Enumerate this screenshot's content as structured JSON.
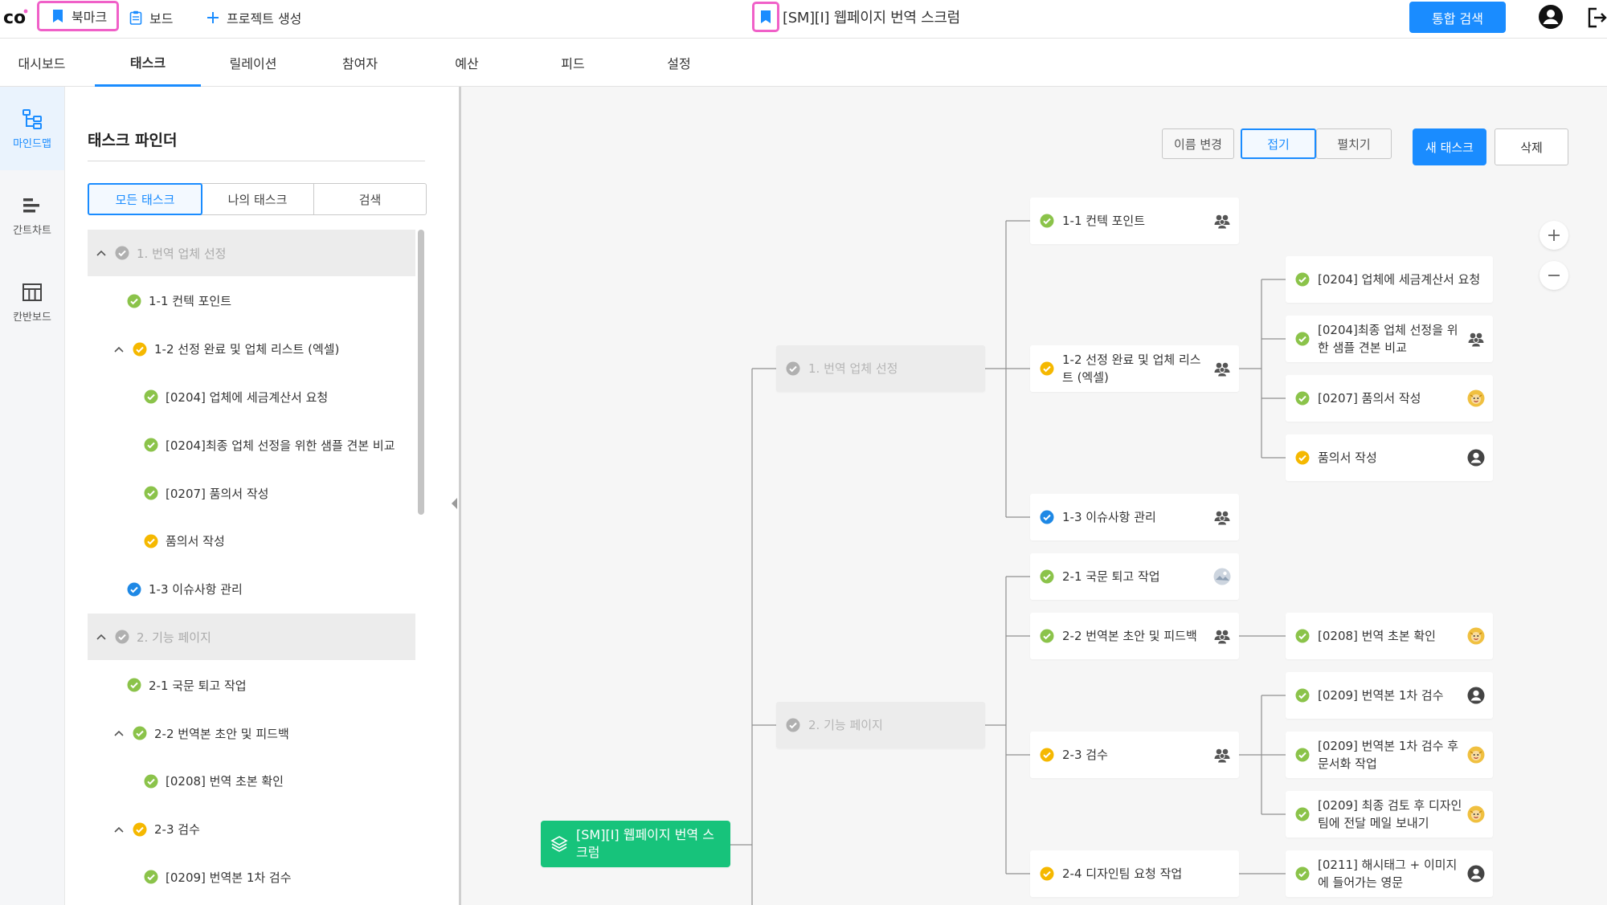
{
  "topbar": {
    "bookmark_label": "북마크",
    "board_label": "보드",
    "create_project_label": "프로젝트 생성",
    "project_title": "[SM][I] 웹페이지 번역 스크럼",
    "search_button": "통합 검색"
  },
  "nav": {
    "tabs": [
      "대시보드",
      "태스크",
      "릴레이션",
      "참여자",
      "예산",
      "피드",
      "설정"
    ],
    "active": "태스크"
  },
  "rail": {
    "items": [
      "마인드맵",
      "간트차트",
      "칸반보드"
    ],
    "active": "마인드맵"
  },
  "finder": {
    "title": "태스크 파인더",
    "filters": [
      "모든 태스크",
      "나의 태스크",
      "검색"
    ],
    "active_filter": "모든 태스크",
    "tree": [
      {
        "label": "1. 번역 업체 선정",
        "level": 0,
        "status": "gray",
        "caret": true
      },
      {
        "label": "1-1 컨텍 포인트",
        "level": 1,
        "status": "green",
        "caret": false
      },
      {
        "label": "1-2 선정 완료 및 업체 리스트 (엑셀)",
        "level": 1,
        "status": "yellow",
        "caret": true
      },
      {
        "label": "[0204] 업체에 세금계산서 요청",
        "level": 2,
        "status": "green",
        "caret": false
      },
      {
        "label": "[0204]최종 업체 선정을 위한 샘플 견본 비교",
        "level": 2,
        "status": "green",
        "caret": false
      },
      {
        "label": "[0207] 품의서 작성",
        "level": 2,
        "status": "green",
        "caret": false
      },
      {
        "label": "품의서 작성",
        "level": 2,
        "status": "yellow",
        "caret": false
      },
      {
        "label": "1-3 이슈사항 관리",
        "level": 1,
        "status": "blue",
        "caret": false
      },
      {
        "label": "2. 기능 페이지",
        "level": 0,
        "status": "gray",
        "caret": true
      },
      {
        "label": "2-1 국문 퇴고 작업",
        "level": 1,
        "status": "green",
        "caret": false
      },
      {
        "label": "2-2 번역본 초안 및 피드백",
        "level": 1,
        "status": "green",
        "caret": true
      },
      {
        "label": "[0208] 번역 초본 확인",
        "level": 2,
        "status": "green",
        "caret": false
      },
      {
        "label": "2-3 검수",
        "level": 1,
        "status": "yellow",
        "caret": true
      },
      {
        "label": "[0209] 번역본 1차 검수",
        "level": 2,
        "status": "green",
        "caret": false
      }
    ]
  },
  "toolbar": {
    "rename": "이름 변경",
    "collapse": "접기",
    "expand": "펼치기",
    "new_task": "새 태스크",
    "delete": "삭제"
  },
  "colors": {
    "accent": "#1a8cff",
    "highlight": "#f060c8",
    "green": "#8bc34a",
    "yellow": "#f5b800",
    "blue": "#1e88e5",
    "gray": "#b0b0b0",
    "root": "#17c37b"
  },
  "mindmap": {
    "root": {
      "label": "[SM][I] 웹페이지 번역 스크럼",
      "icon": "layers-icon"
    },
    "groups": [
      {
        "id": "g1",
        "label": "1. 번역 업체 선정",
        "status": "gray"
      },
      {
        "id": "g2",
        "label": "2. 기능 페이지",
        "status": "gray"
      }
    ],
    "tasks": [
      {
        "id": "t11",
        "label": "1-1 컨텍 포인트",
        "status": "green",
        "avatar": "group-icon"
      },
      {
        "id": "t12",
        "label": "1-2 선정 완료 및 업체 리스트 (엑셀)",
        "status": "yellow",
        "avatar": "group-icon"
      },
      {
        "id": "t13",
        "label": "1-3 이슈사항 관리",
        "status": "blue",
        "avatar": "group-icon"
      },
      {
        "id": "t21",
        "label": "2-1 국문 퇴고 작업",
        "status": "green",
        "avatar": "photo-avatar-icon"
      },
      {
        "id": "t22",
        "label": "2-2 번역본 초안 및 피드백",
        "status": "green",
        "avatar": "group-icon"
      },
      {
        "id": "t23",
        "label": "2-3 검수",
        "status": "yellow",
        "avatar": "group-icon"
      },
      {
        "id": "t24",
        "label": "2-4 디자인팀 요청 작업",
        "status": "yellow",
        "avatar": "none"
      }
    ],
    "subtasks": [
      {
        "id": "s1",
        "label": "[0204] 업체에 세금계산서 요청",
        "status": "green",
        "avatar": "none"
      },
      {
        "id": "s2",
        "label": "[0204]최종 업체 선정을 위한 샘플 견본 비교",
        "status": "green",
        "avatar": "group-icon"
      },
      {
        "id": "s3",
        "label": "[0207] 품의서 작성",
        "status": "green",
        "avatar": "face-avatar-icon"
      },
      {
        "id": "s4",
        "label": "품의서 작성",
        "status": "yellow",
        "avatar": "user-avatar-icon"
      },
      {
        "id": "s5",
        "label": "[0208] 번역 초본 확인",
        "status": "green",
        "avatar": "face-avatar-icon"
      },
      {
        "id": "s6",
        "label": "[0209] 번역본 1차 검수",
        "status": "green",
        "avatar": "user-avatar-icon"
      },
      {
        "id": "s7",
        "label": "[0209] 번역본 1차 검수 후 문서화 작업",
        "status": "green",
        "avatar": "face-avatar-icon"
      },
      {
        "id": "s8",
        "label": "[0209] 최종 검토 후 디자인팀에 전달 메일 보내기",
        "status": "green",
        "avatar": "face-avatar-icon"
      },
      {
        "id": "s9",
        "label": "[0211] 해시태그 + 이미지에 들어가는 영문",
        "status": "green",
        "avatar": "user-avatar-icon"
      }
    ]
  }
}
